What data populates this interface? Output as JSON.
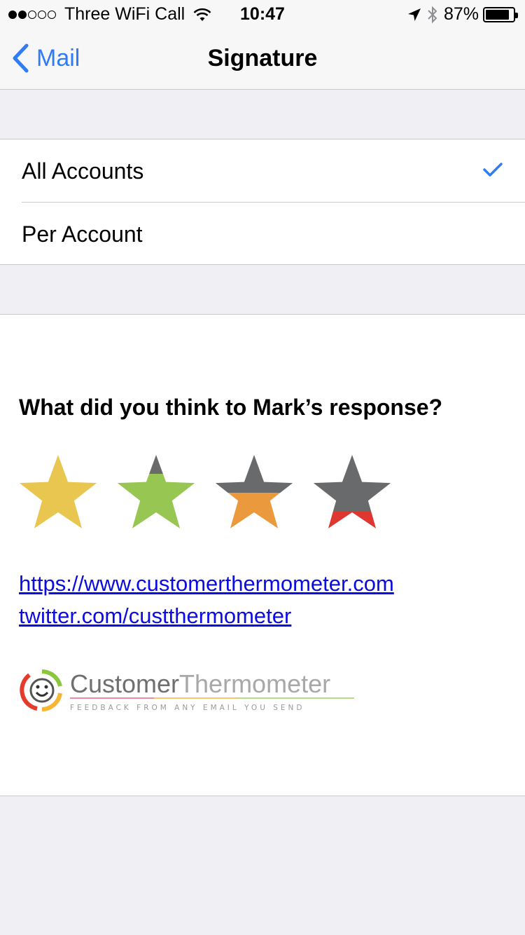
{
  "status_bar": {
    "carrier": "Three WiFi Call",
    "time": "10:47",
    "battery": "87%",
    "battery_level": 0.87,
    "signal_bars_filled": 2,
    "signal_bars_total": 5
  },
  "nav": {
    "back_label": "Mail",
    "title": "Signature"
  },
  "options": {
    "items": [
      {
        "label": "All Accounts",
        "selected": true
      },
      {
        "label": "Per Account",
        "selected": false
      }
    ]
  },
  "signature": {
    "heading": "What did you think to Mark’s response?",
    "ratings": [
      {
        "icon": "star-icon",
        "color": "#e8c650",
        "fill_level": 1.0
      },
      {
        "icon": "star-icon",
        "color": "#97c653",
        "fill_level": 0.75
      },
      {
        "icon": "star-icon",
        "color": "#ea9a3c",
        "fill_level": 0.5
      },
      {
        "icon": "star-icon",
        "color": "#dd3730",
        "fill_level": 0.25
      }
    ],
    "links": {
      "website": "https://www.customerthermometer.com",
      "twitter": "twitter.com/custthermometer"
    },
    "logo": {
      "name_part1": "Customer",
      "name_part2": "Thermometer",
      "tagline": "FEEDBACK FROM ANY EMAIL YOU SEND"
    }
  },
  "colors": {
    "accent": "#2f7cf6",
    "link": "#0b0ce0",
    "background": "#efeff4",
    "star_empty": "#696a6c"
  }
}
